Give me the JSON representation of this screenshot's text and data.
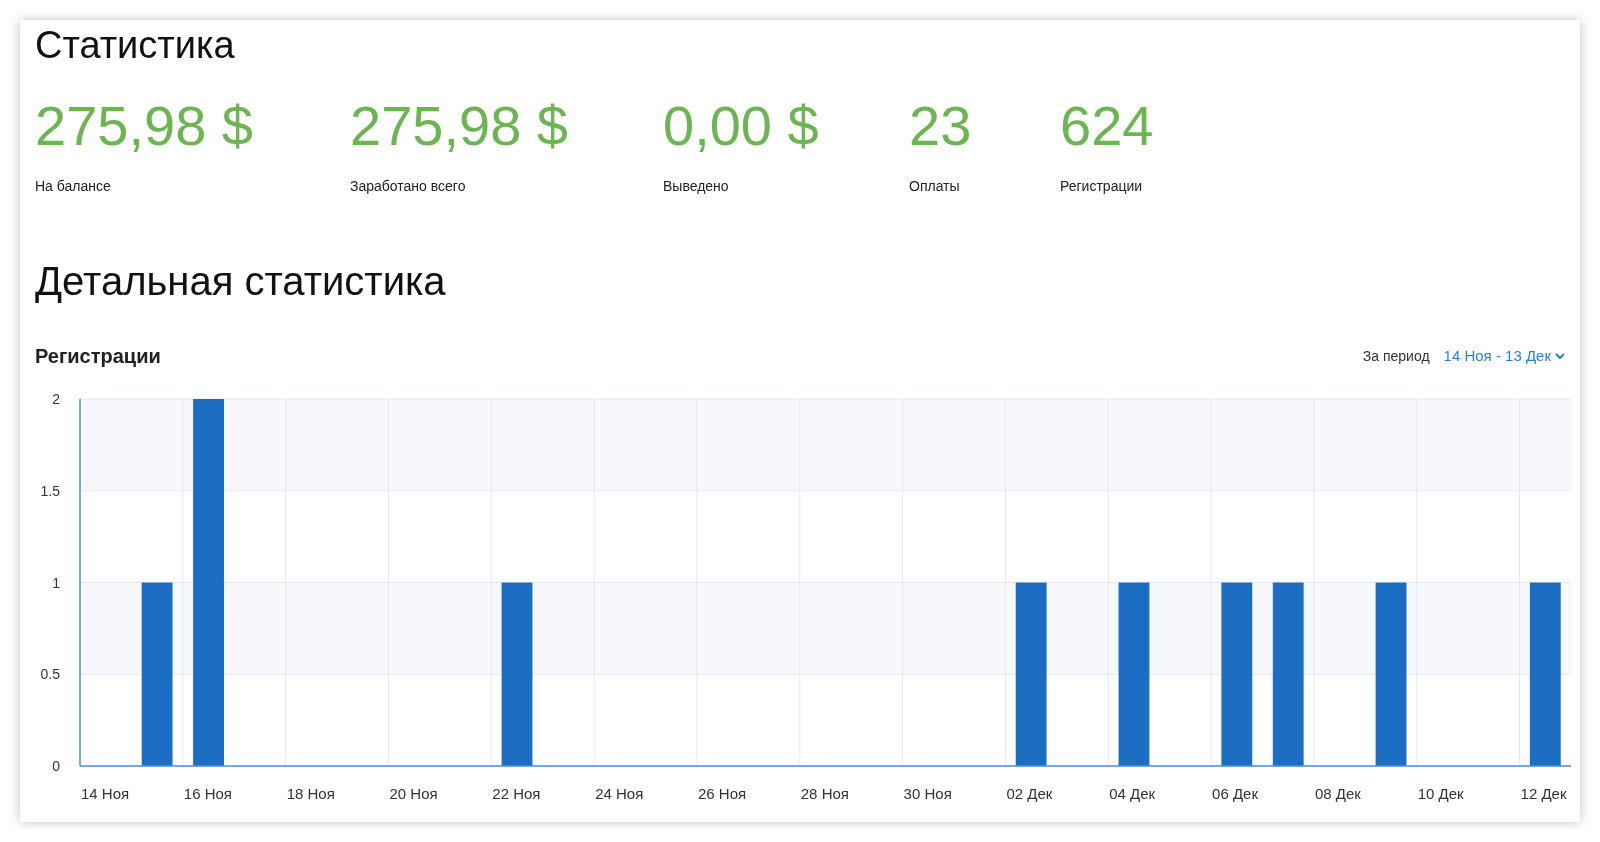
{
  "title": "Статистика",
  "stats": [
    {
      "value": "275,98 $",
      "label": "На балансе"
    },
    {
      "value": "275,98 $",
      "label": "Заработано всего"
    },
    {
      "value": "0,00 $",
      "label": "Выведено"
    },
    {
      "value": "23",
      "label": "Оплаты"
    },
    {
      "value": "624",
      "label": "Регистрации"
    }
  ],
  "detail_title": "Детальная статистика",
  "chart_panel": {
    "title": "Регистрации",
    "period_label": "За период",
    "period_value": "14 Ноя - 13 Дек",
    "chart_data": {
      "type": "bar",
      "categories": [
        "14 Ноя",
        null,
        "16 Ноя",
        null,
        "18 Ноя",
        null,
        "20 Ноя",
        null,
        "22 Ноя",
        null,
        "24 Ноя",
        null,
        "26 Ноя",
        null,
        "28 Ноя",
        null,
        "30 Ноя",
        null,
        "02 Дек",
        null,
        "04 Дек",
        null,
        "06 Дек",
        null,
        "08 Дек",
        null,
        "10 Дек",
        null,
        "12 Дек"
      ],
      "series": [
        {
          "color": "#1b6ec2",
          "values": [
            0,
            1,
            2,
            0,
            0,
            0,
            0,
            0,
            1,
            0,
            0,
            0,
            0,
            0,
            0,
            0,
            0,
            0,
            1,
            0,
            1,
            0,
            1,
            1,
            0,
            1,
            0,
            0,
            1
          ]
        }
      ],
      "ylim": [
        0,
        2
      ],
      "yticks": [
        0,
        0.5,
        1,
        1.5,
        2
      ],
      "grid": true
    }
  }
}
